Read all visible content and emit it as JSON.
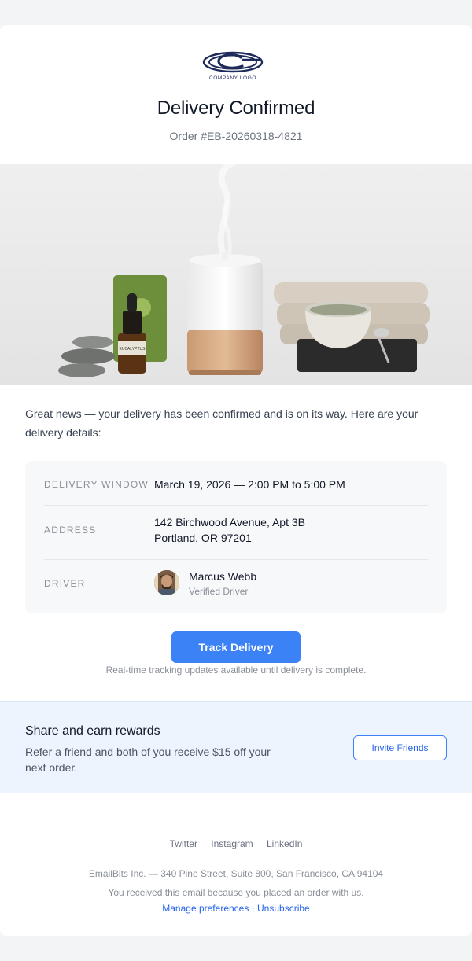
{
  "header": {
    "logo_text": "COMPANY LOGO",
    "title": "Delivery Confirmed",
    "order": "Order #EB-20260318-4821"
  },
  "hero": {
    "bottle_label": "EUCALYPTUS"
  },
  "intro": "Great news — your delivery has been confirmed and is on its way. Here are your delivery details:",
  "details": {
    "window_label": "DELIVERY WINDOW",
    "window_value": "March 19, 2026 — 2:00 PM to 5:00 PM",
    "address_label": "ADDRESS",
    "address_line1": "142 Birchwood Avenue, Apt 3B",
    "address_line2": "Portland, OR 97201",
    "driver_label": "DRIVER",
    "driver_name": "Marcus Webb",
    "driver_status": "Verified Driver"
  },
  "track": {
    "button": "Track Delivery",
    "note": "Real-time tracking updates available until delivery is complete."
  },
  "promo": {
    "title": "Share and earn rewards",
    "text": "Refer a friend and both of you receive $15 off your next order.",
    "button": "Invite Friends"
  },
  "footer": {
    "social": [
      "Twitter",
      "Instagram",
      "LinkedIn"
    ],
    "address": "EmailBits Inc. — 340 Pine Street, Suite 800, San Francisco, CA 94104",
    "reason": "You received this email because you placed an order with us.",
    "manage": "Manage preferences",
    "separator": " · ",
    "unsubscribe": "Unsubscribe"
  },
  "colors": {
    "accent": "#3b82f6",
    "promo_bg": "#eef4fd",
    "page_bg": "#f3f4f6"
  }
}
